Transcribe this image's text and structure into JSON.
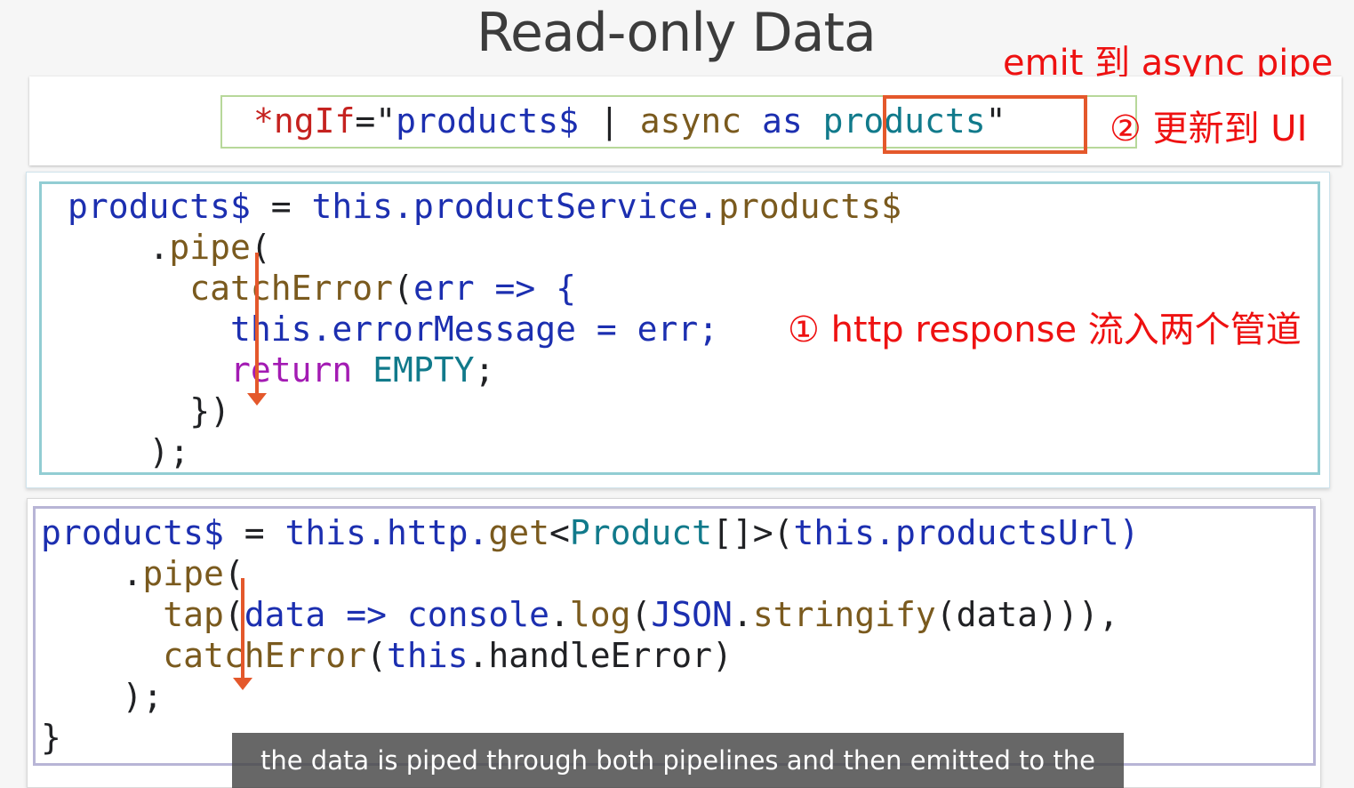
{
  "title": "Read-only Data",
  "annotations": {
    "emit": "emit 到 async pipe",
    "update": "② 更新到 UI",
    "http": "① http response 流入两个管道"
  },
  "code_template": {
    "prefix": "*ngIf",
    "eq_quote": "=\"",
    "stream": "products$",
    "pipe_op": " | ",
    "async": "async",
    "as": "as",
    "alias": "products",
    "close_quote": "\""
  },
  "code_component": {
    "l1_a": "products$",
    "l1_b": " = ",
    "l1_c": "this",
    "l1_d": ".productService.",
    "l1_e": "products$",
    "l2_a": "    .",
    "l2_b": "pipe",
    "l2_c": "(",
    "l3_a": "      catchError",
    "l3_b": "(",
    "l3_c": "err",
    "l3_d": " => {",
    "l4_a": "        this",
    "l4_b": ".errorMessage = err;",
    "l5_a": "        return",
    "l5_b": " EMPTY",
    "l5_c": ";",
    "l6": "      })",
    "l7": "    );"
  },
  "code_service": {
    "l1_a": "products$",
    "l1_b": " = ",
    "l1_c": "this",
    "l1_d": ".http.",
    "l1_e": "get",
    "l1_f": "<",
    "l1_g": "Product",
    "l1_h": "[]>(",
    "l1_i": "this",
    "l1_j": ".productsUrl)",
    "l2_a": "    .",
    "l2_b": "pipe",
    "l2_c": "(",
    "l3_a": "      tap",
    "l3_b": "(",
    "l3_c": "data",
    "l3_d": " => ",
    "l3_e": "console",
    "l3_f": ".",
    "l3_g": "log",
    "l3_h": "(",
    "l3_i": "JSON",
    "l3_j": ".",
    "l3_k": "stringify",
    "l3_l": "(data))),",
    "l4_a": "      catchError",
    "l4_b": "(",
    "l4_c": "this",
    "l4_d": ".handleError)",
    "l5": "    );",
    "l6": "}"
  },
  "caption": "the data is piped through both pipelines and then emitted to the",
  "colors": {
    "annotation_red": "#ee1111",
    "arrow_orange": "#e4582b",
    "keyword_blue": "#1c2fb0",
    "method_brown": "#7a5a1e",
    "type_teal": "#117a8b",
    "return_magenta": "#a31bb3"
  }
}
